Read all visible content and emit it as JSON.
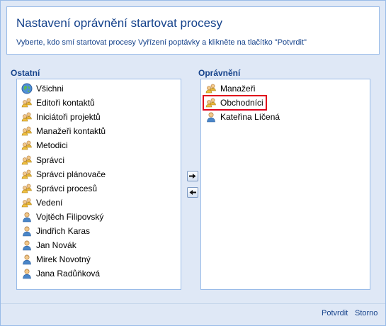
{
  "header": {
    "title": "Nastavení oprávnění startovat procesy",
    "subtitle": "Vyberte, kdo smí startovat procesy Vyřízení poptávky a klikněte na tlačítko \"Potvrdit\""
  },
  "left": {
    "label": "Ostatní",
    "items": [
      {
        "label": "Všichni",
        "icon": "globe-icon"
      },
      {
        "label": "Editoři kontaktů",
        "icon": "group-icon"
      },
      {
        "label": "Iniciátoři projektů",
        "icon": "group-icon"
      },
      {
        "label": "Manažeři kontaktů",
        "icon": "group-icon"
      },
      {
        "label": "Metodici",
        "icon": "group-icon"
      },
      {
        "label": "Správci",
        "icon": "group-icon"
      },
      {
        "label": "Správci plánovače",
        "icon": "group-icon"
      },
      {
        "label": "Správci procesů",
        "icon": "group-icon"
      },
      {
        "label": "Vedení",
        "icon": "group-icon"
      },
      {
        "label": "Vojtěch Filipovský",
        "icon": "user-icon"
      },
      {
        "label": "Jindřich Karas",
        "icon": "user-icon"
      },
      {
        "label": "Jan Novák",
        "icon": "user-icon"
      },
      {
        "label": "Mirek Novotný",
        "icon": "user-icon"
      },
      {
        "label": "Jana Radůňková",
        "icon": "user-icon"
      }
    ]
  },
  "right": {
    "label": "Oprávnění",
    "items": [
      {
        "label": "Manažeři",
        "icon": "group-icon"
      },
      {
        "label": "Obchodníci",
        "icon": "group-icon",
        "selected": true
      },
      {
        "label": "Kateřina Líčená",
        "icon": "user-icon"
      }
    ]
  },
  "buttons": {
    "add_icon": "arrow-right-icon",
    "remove_icon": "arrow-left-icon",
    "confirm": "Potvrdit",
    "cancel": "Storno"
  },
  "colors": {
    "panel": "#dfe8f6",
    "border": "#99bbe8",
    "title": "#15428b",
    "selection_outline": "#e0001b"
  }
}
